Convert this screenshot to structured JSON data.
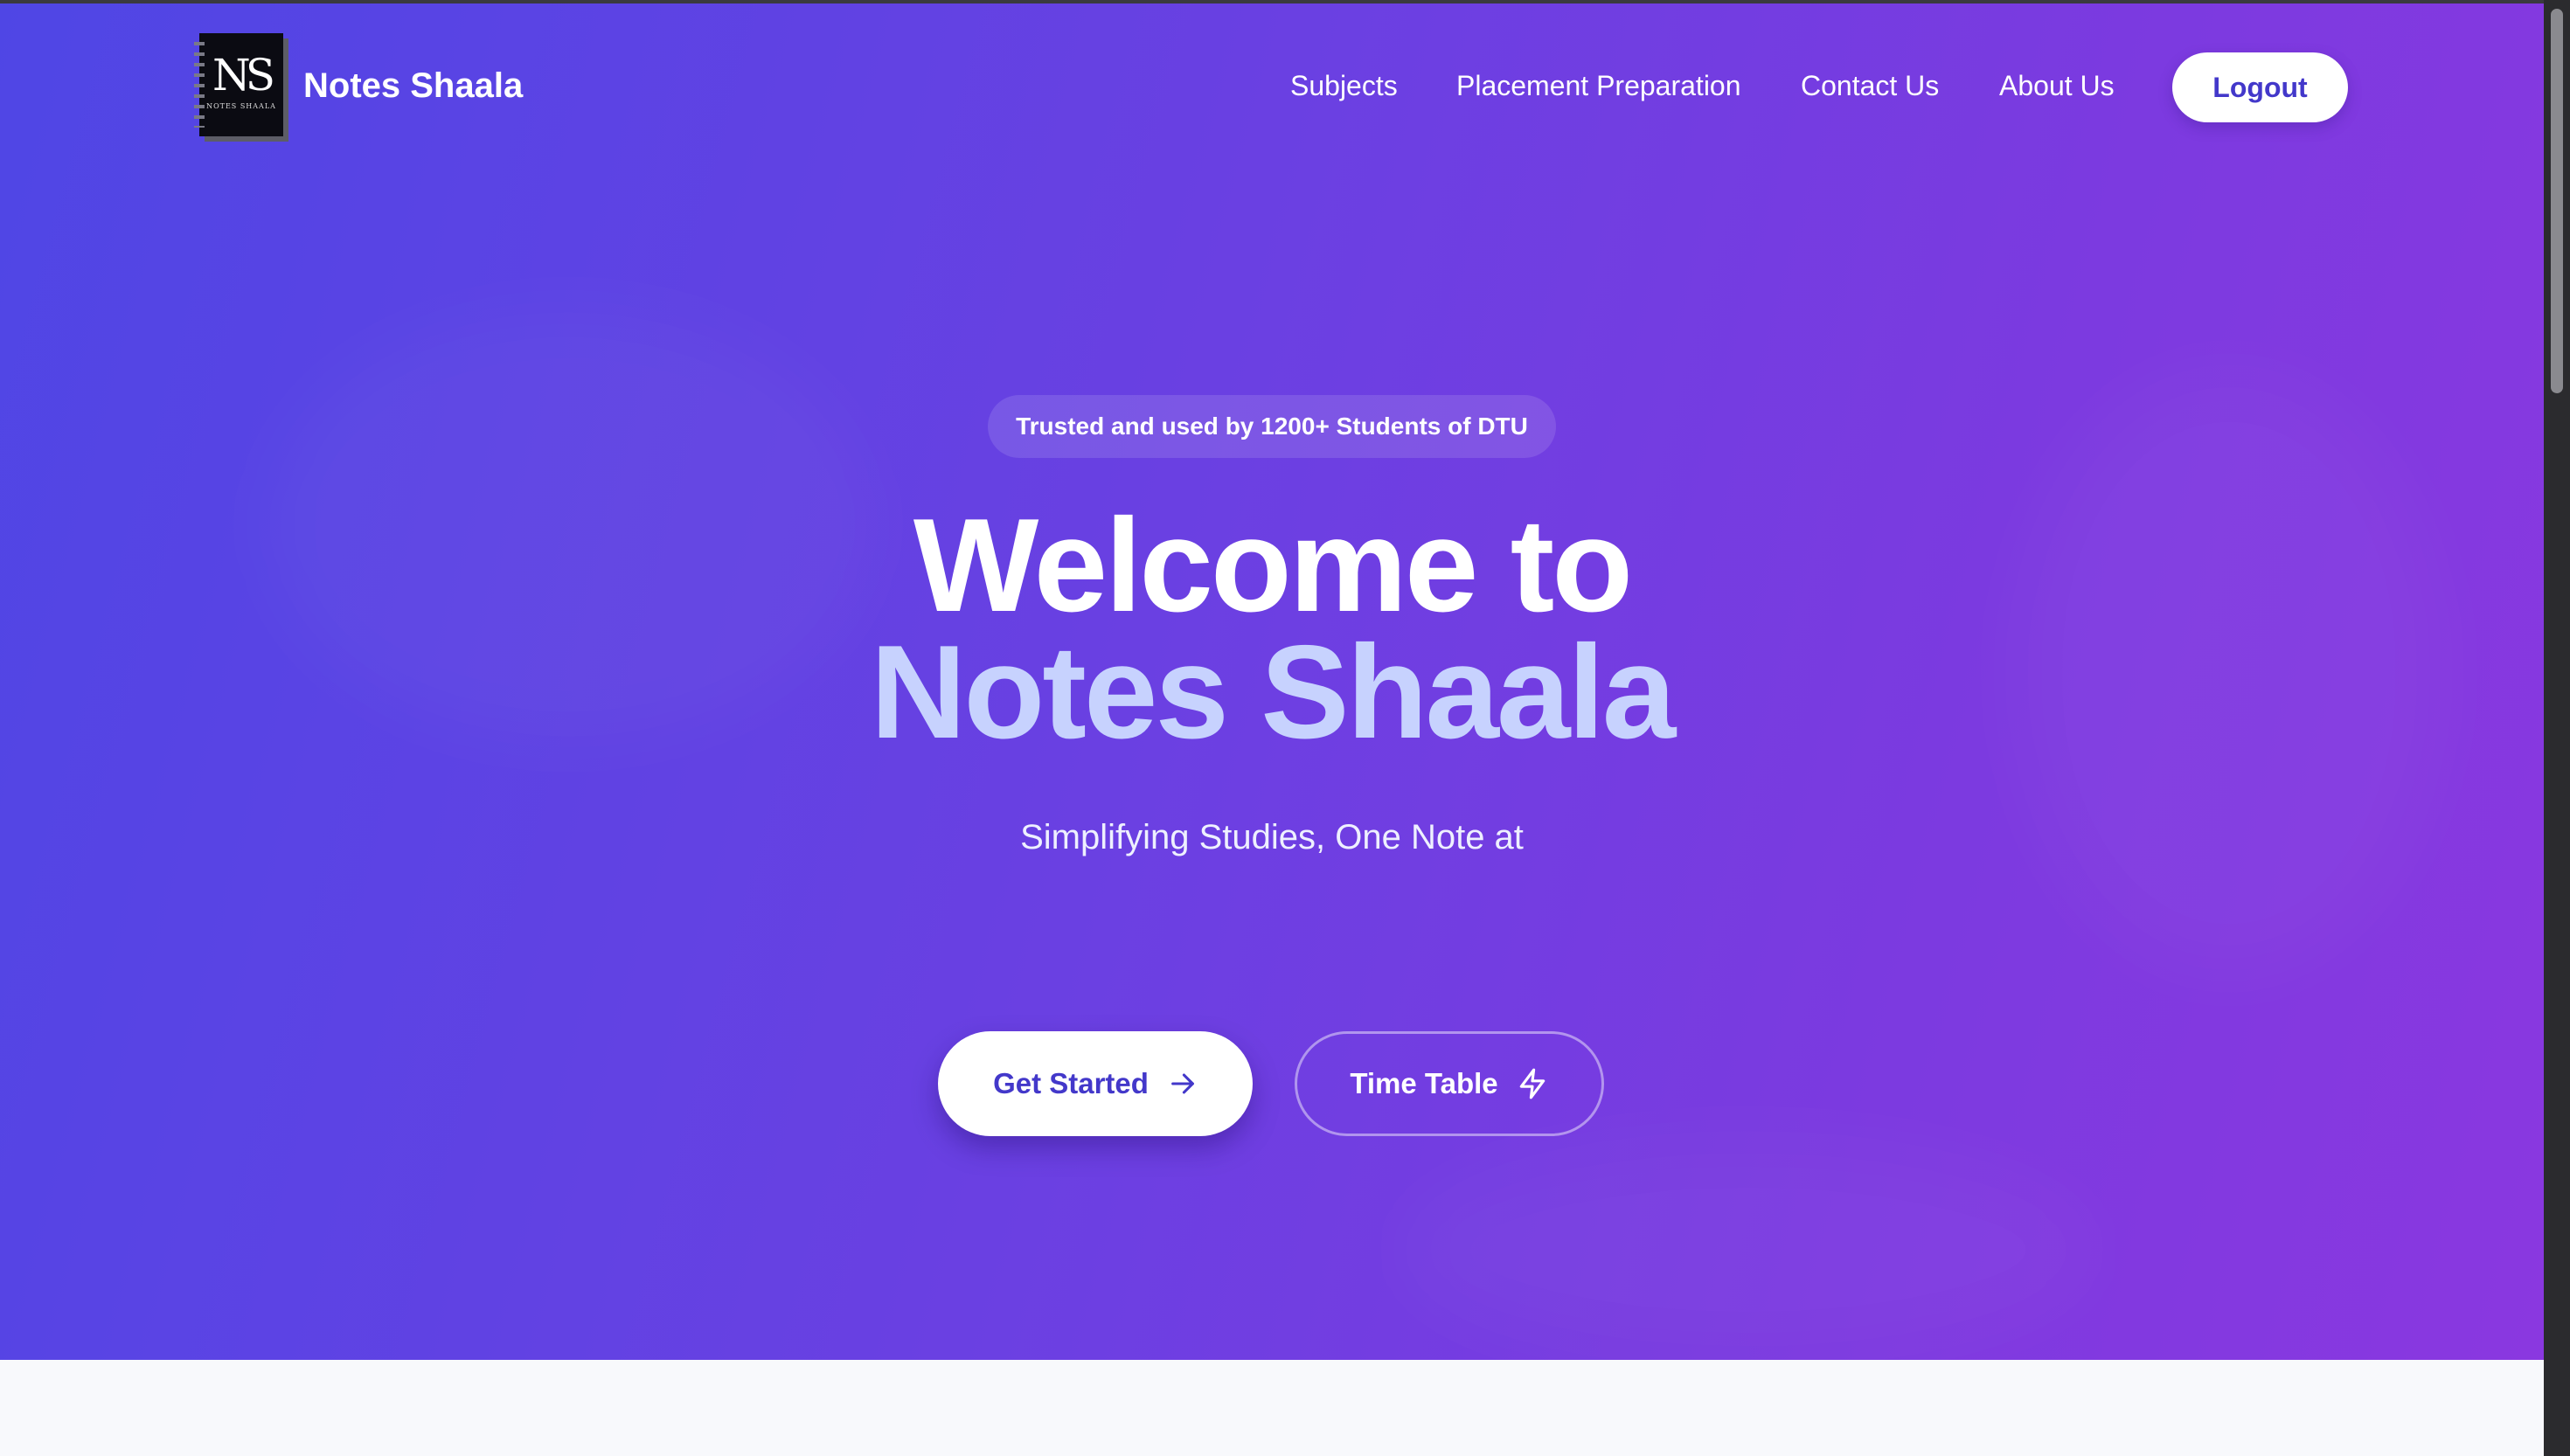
{
  "brand": {
    "name": "Notes Shaala",
    "logo_monogram": "NS",
    "logo_caption": "NOTES SHAALA"
  },
  "nav": {
    "links": [
      "Subjects",
      "Placement Preparation",
      "Contact Us",
      "About Us"
    ],
    "logout_label": "Logout"
  },
  "hero": {
    "badge": "Trusted and used by 1200+ Students of DTU",
    "title_line1": "Welcome to",
    "title_line2": "Notes Shaala",
    "subtitle": "Simplifying Studies, One Note at",
    "primary_button": "Get Started",
    "secondary_button": "Time Table"
  },
  "colors": {
    "gradient_start": "#4f46e5",
    "gradient_end": "#8a38e0",
    "accent_text": "#c7d2fe",
    "button_text": "#4338ca"
  },
  "icons": {
    "primary_button_icon": "arrow-right-icon",
    "secondary_button_icon": "lightning-bolt-icon"
  }
}
